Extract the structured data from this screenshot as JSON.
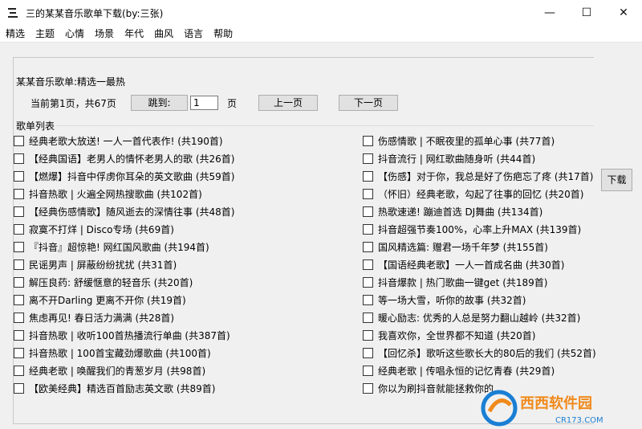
{
  "window": {
    "title": "三的某某音乐歌单下载(by:三张)",
    "minimize_glyph": "—",
    "maximize_glyph": "☐",
    "close_glyph": "✕"
  },
  "menu": [
    "精选",
    "主题",
    "心情",
    "场景",
    "年代",
    "曲风",
    "语言",
    "帮助"
  ],
  "playlist_title": "某某音乐歌单:精选一最热",
  "pagination": {
    "info": "当前第1页，共67页",
    "jump_label": "跳到:",
    "page_value": "1",
    "page_unit": "页",
    "prev_label": "上一页",
    "next_label": "下一页"
  },
  "list_group_label": "歌单列表",
  "download_label": "下载",
  "playlists_left": [
    "经典老歌大放送! 一人一首代表作!  (共190首)",
    "【经典国语】老男人的情怀老男人的歌 (共26首)",
    "【燃爆】抖音中俘虏你耳朵的英文歌曲 (共59首)",
    "抖音热歌 | 火遍全网热搜歌曲  (共102首)",
    "【经典伤感情歌】随风逝去的深情往事  (共48首)",
    "寂寞不打烊 | Disco专场  (共69首)",
    "『抖音』超惊艳! 网红国风歌曲 (共194首)",
    "民谣男声 | 屏蔽纷纷扰扰  (共31首)",
    "解压良药: 舒缓惬意的轻音乐  (共20首)",
    "离不开Darling 更离不开你  (共19首)",
    "焦虑再见! 春日活力满满  (共28首)",
    "抖音热歌 | 收听100首热播流行单曲  (共387首)",
    "抖音热歌 | 100首宝藏劲爆歌曲  (共100首)",
    "经典老歌 | 唤醒我们的青葱岁月  (共98首)",
    "【欧美经典】精选百首励志英文歌  (共89首)"
  ],
  "playlists_right": [
    "伤感情歌 | 不眠夜里的孤单心事  (共77首)",
    "抖音流行 | 网红歌曲随身听  (共44首)",
    "【伤感】对于你，我总是好了伤疤忘了疼  (共17首)",
    "（怀旧）经典老歌，勾起了往事的回忆  (共20首)",
    "热歌速递! 蹦迪首选 DJ舞曲  (共134首)",
    "抖音超强节奏100%，心率上升MAX  (共139首)",
    "国风精选篇: 赠君一场千年梦  (共155首)",
    "【国语经典老歌】一人一首成名曲  (共30首)",
    "抖音爆款 | 热门歌曲一键get  (共189首)",
    "等一场大雪，听你的故事  (共32首)",
    "暖心励志: 优秀的人总是努力翻山越岭  (共32首)",
    "我喜欢你，全世界都不知道  (共20首)",
    "【回忆杀】歌听这些歌长大的80后的我们  (共52首)",
    "经典老歌 | 传唱永恒的记忆青春  (共29首)",
    "你以为刷抖音就能拯救你的"
  ],
  "watermark": {
    "brand": "西西软件园",
    "domain": "CR173.COM",
    "colors": {
      "orange": "#f08a1c",
      "blue": "#1a7fd4"
    }
  }
}
